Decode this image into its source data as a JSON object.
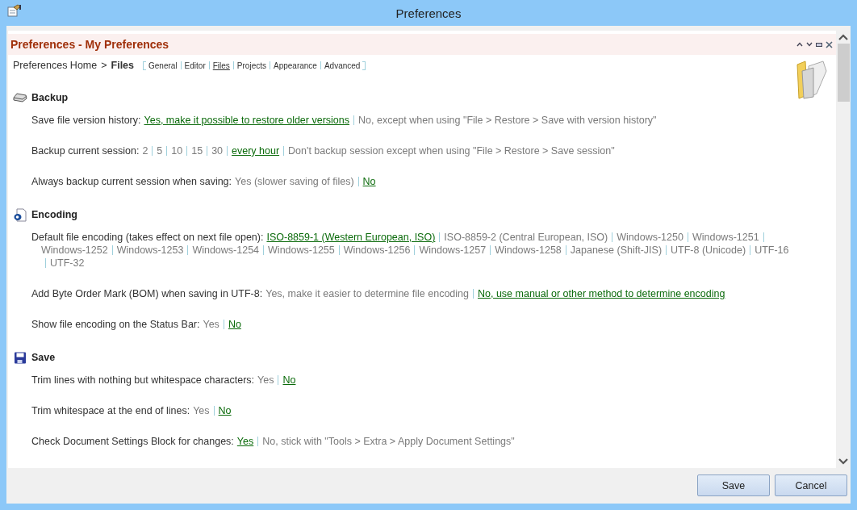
{
  "window": {
    "title": "Preferences"
  },
  "panel": {
    "title": "Preferences - My Preferences"
  },
  "breadcrumb": {
    "home": "Preferences Home",
    "separator": ">",
    "current": "Files"
  },
  "nav": [
    {
      "label": "General",
      "selected": false
    },
    {
      "label": "Editor",
      "selected": false
    },
    {
      "label": "Files",
      "selected": true
    },
    {
      "label": "Projects",
      "selected": false
    },
    {
      "label": "Appearance",
      "selected": false
    },
    {
      "label": "Advanced",
      "selected": false
    }
  ],
  "sections": [
    {
      "title": "Backup",
      "kind": "drive",
      "settings": [
        {
          "label": "Save file version history:",
          "options": [
            {
              "text": "Yes, make it possible to restore older versions",
              "selected": true
            },
            {
              "text": "No, except when using \"File > Restore > Save with version history\"",
              "selected": false
            }
          ]
        },
        {
          "label": "Backup current session:",
          "options": [
            {
              "text": "2",
              "selected": false
            },
            {
              "text": "5",
              "selected": false
            },
            {
              "text": "10",
              "selected": false
            },
            {
              "text": "15",
              "selected": false
            },
            {
              "text": "30",
              "selected": false
            },
            {
              "text": "every hour",
              "selected": true
            },
            {
              "text": "Don't backup session except when using \"File > Restore > Save session\"",
              "selected": false
            }
          ]
        },
        {
          "label": "Always backup current session when saving:",
          "options": [
            {
              "text": "Yes (slower saving of files)",
              "selected": false
            },
            {
              "text": "No",
              "selected": true
            }
          ]
        }
      ]
    },
    {
      "title": "Encoding",
      "kind": "document",
      "settings": [
        {
          "label": "Default file encoding (takes effect on next file open):",
          "options": [
            {
              "text": "ISO-8859-1 (Western European, ISO)",
              "selected": true
            },
            {
              "text": "ISO-8859-2 (Central European, ISO)",
              "selected": false
            },
            {
              "text": "Windows-1250",
              "selected": false
            },
            {
              "text": "Windows-1251",
              "selected": false
            },
            {
              "text": "Windows-1252",
              "selected": false
            },
            {
              "text": "Windows-1253",
              "selected": false
            },
            {
              "text": "Windows-1254",
              "selected": false
            },
            {
              "text": "Windows-1255",
              "selected": false
            },
            {
              "text": "Windows-1256",
              "selected": false
            },
            {
              "text": "Windows-1257",
              "selected": false
            },
            {
              "text": "Windows-1258",
              "selected": false
            },
            {
              "text": "Japanese (Shift-JIS)",
              "selected": false
            },
            {
              "text": "UTF-8 (Unicode)",
              "selected": false
            },
            {
              "text": "UTF-16",
              "selected": false
            },
            {
              "text": "UTF-32",
              "selected": false
            }
          ]
        },
        {
          "label": "Add Byte Order Mark (BOM) when saving in UTF-8:",
          "options": [
            {
              "text": "Yes, make it easier to determine file encoding",
              "selected": false
            },
            {
              "text": "No, use manual or other method to determine encoding",
              "selected": true
            }
          ]
        },
        {
          "label": "Show file encoding on the Status Bar:",
          "options": [
            {
              "text": "Yes",
              "selected": false
            },
            {
              "text": "No",
              "selected": true
            }
          ]
        }
      ]
    },
    {
      "title": "Save",
      "kind": "floppy",
      "settings": [
        {
          "label": "Trim lines with nothing but whitespace characters:",
          "options": [
            {
              "text": "Yes",
              "selected": false
            },
            {
              "text": "No",
              "selected": true
            }
          ]
        },
        {
          "label": "Trim whitespace at the end of lines:",
          "options": [
            {
              "text": "Yes",
              "selected": false
            },
            {
              "text": "No",
              "selected": true
            }
          ]
        },
        {
          "label": "Check Document Settings Block for changes:",
          "options": [
            {
              "text": "Yes",
              "selected": true
            },
            {
              "text": "No, stick with \"Tools > Extra > Apply Document Settings\"",
              "selected": false
            }
          ]
        }
      ]
    }
  ],
  "buttons": [
    {
      "label": "Save"
    },
    {
      "label": "Cancel"
    }
  ]
}
